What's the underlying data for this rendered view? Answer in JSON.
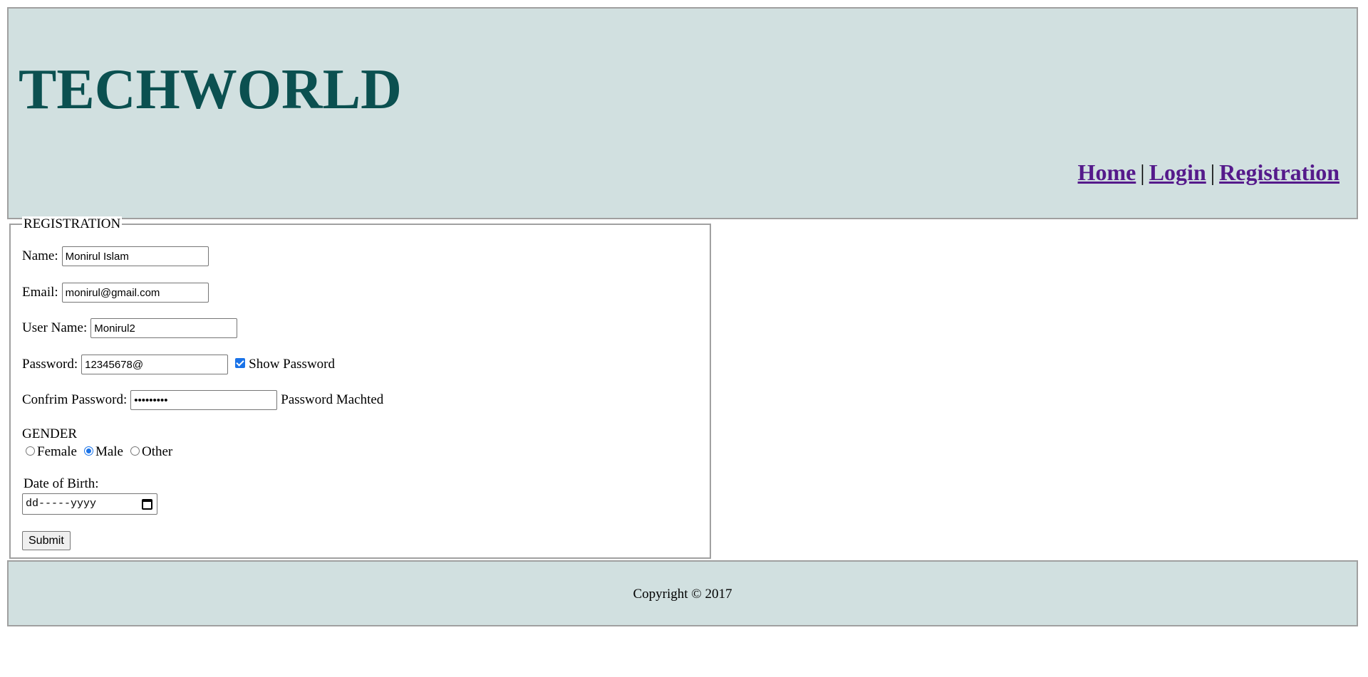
{
  "header": {
    "title": "TECHWORLD",
    "nav": [
      {
        "label": "Home"
      },
      {
        "label": "Login"
      },
      {
        "label": "Registration"
      }
    ],
    "separator": "|"
  },
  "form": {
    "legend": "REGISTRATION",
    "name": {
      "label": "Name:",
      "value": "Monirul Islam"
    },
    "email": {
      "label": "Email:",
      "value": "monirul@gmail.com"
    },
    "username": {
      "label": "User Name:",
      "value": "Monirul2"
    },
    "password": {
      "label": "Password:",
      "value": "12345678@",
      "show_password_label": "Show Password",
      "show_password_checked": true
    },
    "confirm_password": {
      "label": "Confrim Password:",
      "value": "•••••••••",
      "status": "Password Machted"
    },
    "gender": {
      "label": "GENDER",
      "options": [
        {
          "label": "Female",
          "checked": false
        },
        {
          "label": "Male",
          "checked": true
        },
        {
          "label": "Other",
          "checked": false
        }
      ]
    },
    "dob": {
      "label": "Date of Birth:",
      "placeholder": "dd-----yyyy"
    },
    "submit_label": "Submit"
  },
  "footer": {
    "copyright": "Copyright © 2017"
  },
  "colors": {
    "panel_bg": "#d1e0e0",
    "title": "#0b5050",
    "link": "#551a8b",
    "accent": "#1a73e8"
  }
}
